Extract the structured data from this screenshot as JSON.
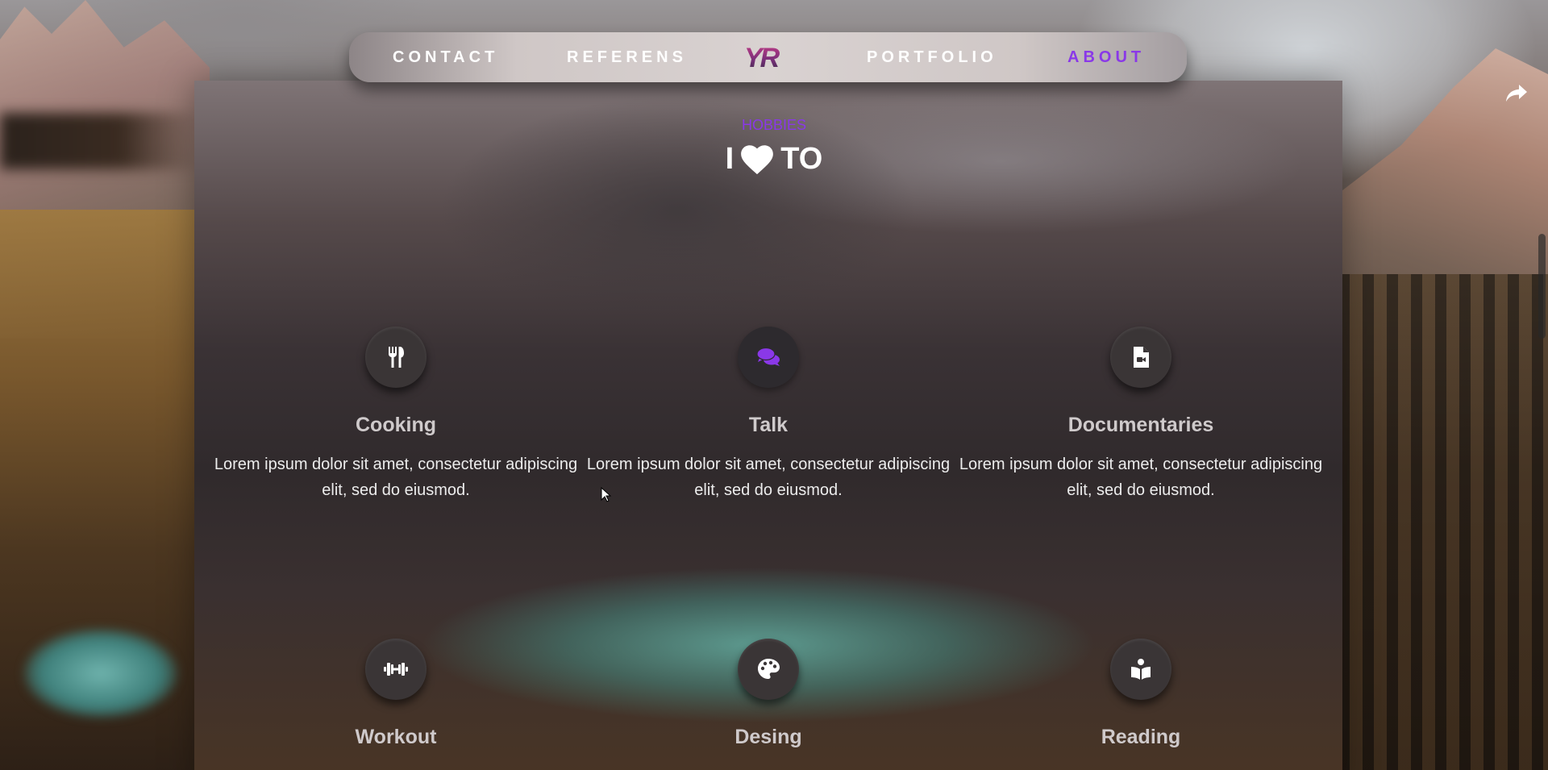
{
  "nav": {
    "items": [
      {
        "label": "CONTACT"
      },
      {
        "label": "REFERENS"
      },
      {
        "label": "PORTFOLIO"
      },
      {
        "label": "ABOUT"
      }
    ],
    "logo_text": "YR",
    "active_item": "ABOUT"
  },
  "section": {
    "kicker": "HOBBIES",
    "title_before": "I",
    "title_icon": "heart-icon",
    "title_after": "TO"
  },
  "hobbies": [
    {
      "title": "Cooking",
      "icon": "utensils-icon",
      "text": "Lorem ipsum dolor sit amet, consectetur adipiscing elit, sed do eiusmod."
    },
    {
      "title": "Talk",
      "icon": "comments-icon",
      "text": "Lorem ipsum dolor sit amet, consectetur adipiscing elit, sed do eiusmod."
    },
    {
      "title": "Documentaries",
      "icon": "file-video-icon",
      "text": "Lorem ipsum dolor sit amet, consectetur adipiscing elit, sed do eiusmod."
    },
    {
      "title": "Workout",
      "icon": "dumbbell-icon"
    },
    {
      "title": "Desing",
      "icon": "palette-icon"
    },
    {
      "title": "Reading",
      "icon": "book-reader-icon"
    }
  ],
  "colors": {
    "accent": "#8a38e8",
    "text": "#ffffff",
    "heading_muted": "#cfcacb",
    "icon_circle": "#3a3536"
  }
}
